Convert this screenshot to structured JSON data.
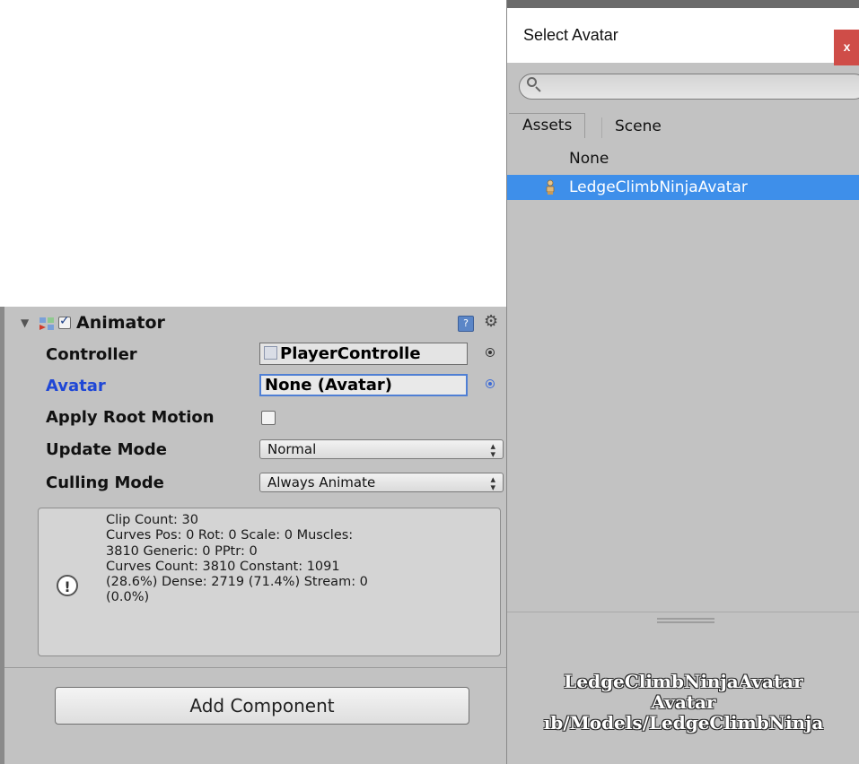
{
  "inspector": {
    "component": {
      "title": "Animator",
      "enabled": true,
      "help_icon": "help-book-icon",
      "gear_icon": "gear-icon"
    },
    "fields": {
      "controller": {
        "label": "Controller",
        "value": "PlayerControlle"
      },
      "avatar": {
        "label": "Avatar",
        "value": "None (Avatar)"
      },
      "apply_root_motion": {
        "label": "Apply Root Motion",
        "checked": false
      },
      "update_mode": {
        "label": "Update Mode",
        "value": "Normal"
      },
      "culling_mode": {
        "label": "Culling Mode",
        "value": "Always Animate"
      }
    },
    "info": {
      "icon": "info-icon",
      "lines": [
        "Clip Count: 30",
        "Curves Pos: 0 Rot: 0 Scale: 0 Muscles:",
        "3810 Generic: 0 PPtr: 0",
        "Curves Count: 3810 Constant: 1091",
        "(28.6%) Dense: 2719 (71.4%) Stream: 0",
        "(0.0%)"
      ]
    },
    "add_component_label": "Add Component"
  },
  "select_window": {
    "title": "Select Avatar",
    "close_label": "x",
    "search": {
      "value": "",
      "placeholder": ""
    },
    "tabs": {
      "assets": "Assets",
      "scene": "Scene"
    },
    "items": [
      {
        "label": "None",
        "selected": false
      },
      {
        "label": "LedgeClimbNinjaAvatar",
        "selected": true,
        "icon": "avatar-icon"
      }
    ],
    "preview": {
      "name": "LedgeClimbNinjaAvatar",
      "type": "Avatar",
      "path": "ıb/Models/LedgeClimbNinja"
    }
  },
  "colors": {
    "selection": "#3e8fea",
    "panel_bg": "#c2c2c2",
    "avatar_label": "#1f47d6",
    "close_button": "#cf4d48"
  }
}
